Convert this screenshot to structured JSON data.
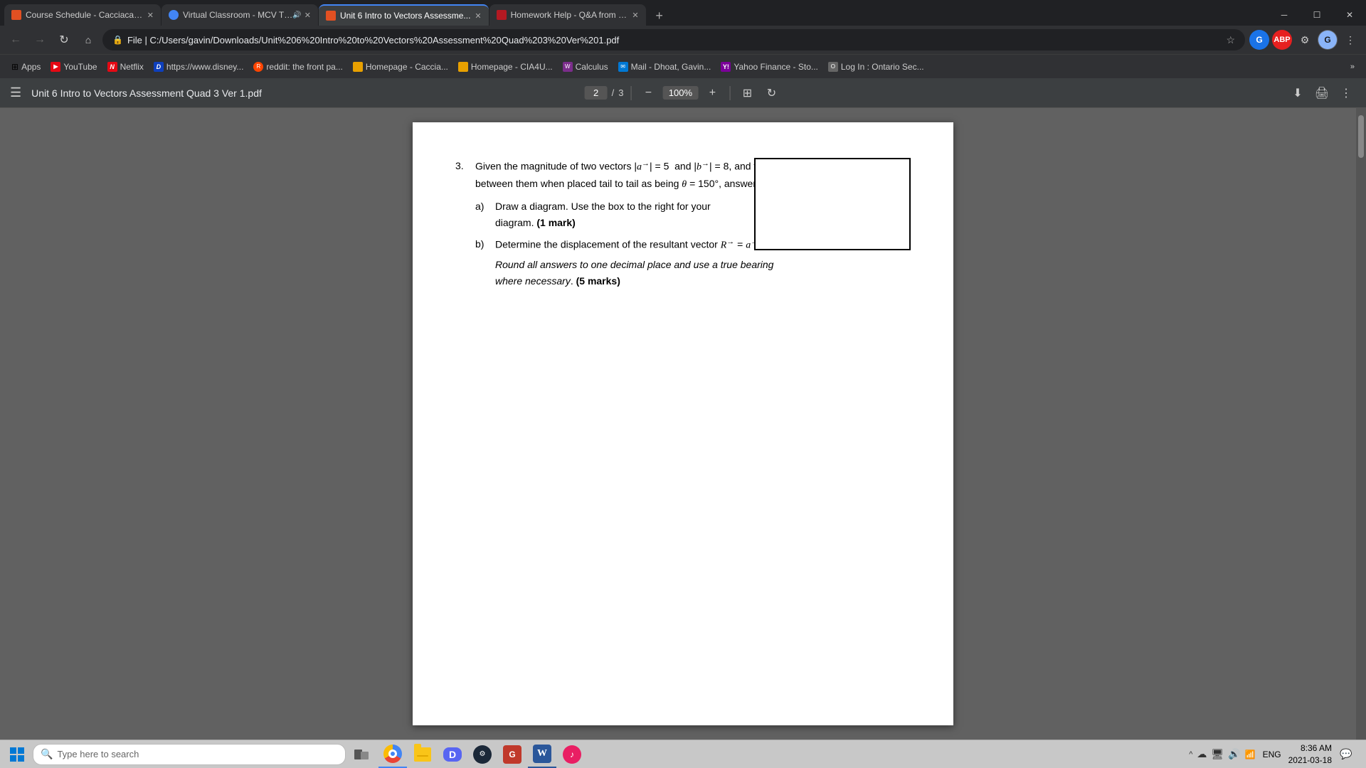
{
  "browser": {
    "tabs": [
      {
        "id": "tab1",
        "title": "Course Schedule - Cacciacarro's",
        "favicon_color": "#e25022",
        "active": false,
        "audio": false
      },
      {
        "id": "tab2",
        "title": "Virtual Classroom - MCV Th...",
        "favicon_color": "#4285f4",
        "active": false,
        "audio": true
      },
      {
        "id": "tab3",
        "title": "Unit 6 Intro to Vectors Assessme...",
        "favicon_color": "#e25022",
        "active": true,
        "audio": false
      },
      {
        "id": "tab4",
        "title": "Homework Help - Q&A from On...",
        "favicon_color": "#b41922",
        "active": false,
        "audio": false
      }
    ],
    "url_display": "File | C:/Users/gavin/Downloads/Unit%206%20Intro%20to%20Vectors%20Assessment%20Quad%203%20Ver%201.pdf",
    "url_full": "C:/Users/gavin/Downloads/Unit%206%20Intro%20to%20Vectors%20Assessment%20Quad%203%20Ver%201.pdf"
  },
  "bookmarks": [
    {
      "label": "Apps",
      "icon": "grid"
    },
    {
      "label": "YouTube",
      "icon": "youtube"
    },
    {
      "label": "Netflix",
      "icon": "netflix"
    },
    {
      "label": "https://www.disney...",
      "icon": "disney"
    },
    {
      "label": "reddit: the front pa...",
      "icon": "reddit"
    },
    {
      "label": "Homepage - Caccia...",
      "icon": "homepage"
    },
    {
      "label": "Homepage - CIA4U...",
      "icon": "homepage2"
    },
    {
      "label": "Calculus",
      "icon": "calculus"
    },
    {
      "label": "Mail - Dhoat, Gavin...",
      "icon": "mail"
    },
    {
      "label": "Yahoo Finance - Sto...",
      "icon": "yahoo"
    },
    {
      "label": "Log In : Ontario Sec...",
      "icon": "ontario"
    }
  ],
  "pdf": {
    "title": "Unit 6 Intro to Vectors Assessment Quad 3 Ver 1.pdf",
    "current_page": "2",
    "total_pages": "3",
    "zoom": "100%",
    "question": {
      "number": "3.",
      "intro": "Given the magnitude of two vectors |a⃗| = 5  and |b⃗| = 8, and the angle between them when placed tail to tail as being θ = 150°, answer the following.",
      "part_a_label": "a)",
      "part_a_text": "Draw a diagram. Use the box to the right for your diagram.",
      "part_a_marks": "(1 mark)",
      "part_b_label": "b)",
      "part_b_text": "Determine the displacement of the resultant vector R⃗ = a⃗ + b⃗ .",
      "part_b_subtext": "Round all answers to one decimal place and use a true bearing where necessary",
      "part_b_marks": "(5 marks)"
    }
  },
  "taskbar": {
    "search_placeholder": "Type here to search",
    "time": "8:36 AM",
    "date": "2021-03-18",
    "language": "ENG",
    "apps": [
      {
        "name": "windows-button",
        "color": "#0078d4"
      },
      {
        "name": "search",
        "color": "#fff"
      },
      {
        "name": "task-view",
        "color": "#0078d4"
      },
      {
        "name": "chrome",
        "color": "#4285f4"
      },
      {
        "name": "file-explorer",
        "color": "#f9c518"
      },
      {
        "name": "discord",
        "color": "#5865f2"
      },
      {
        "name": "steam",
        "color": "#1b2838"
      },
      {
        "name": "game",
        "color": "#c0392b"
      },
      {
        "name": "word",
        "color": "#2b579a"
      },
      {
        "name": "music",
        "color": "#e91e63"
      }
    ]
  }
}
